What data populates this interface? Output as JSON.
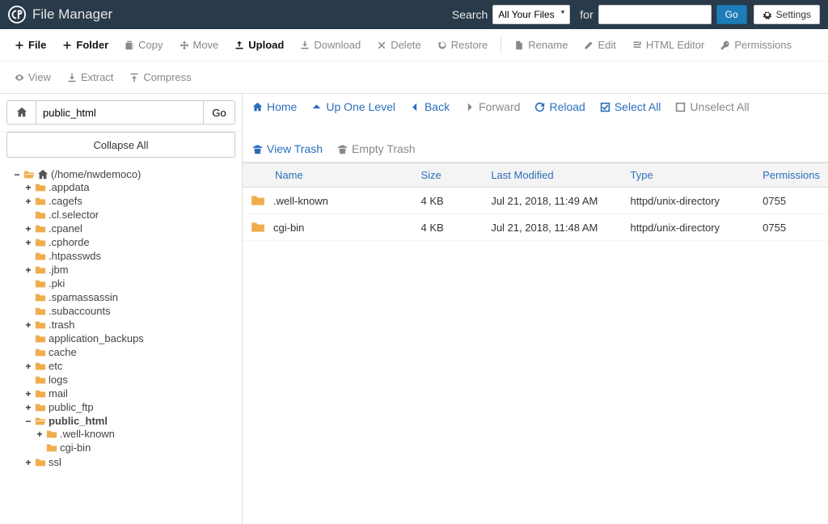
{
  "header": {
    "title": "File Manager",
    "search_label": "Search",
    "search_scope": "All Your Files",
    "for_label": "for",
    "search_term": "",
    "go_label": "Go",
    "settings_label": "Settings"
  },
  "toolbar": {
    "file": "File",
    "folder": "Folder",
    "copy": "Copy",
    "move": "Move",
    "upload": "Upload",
    "download": "Download",
    "delete": "Delete",
    "restore": "Restore",
    "rename": "Rename",
    "edit": "Edit",
    "htmleditor": "HTML Editor",
    "permissions": "Permissions",
    "view": "View",
    "extract": "Extract",
    "compress": "Compress"
  },
  "leftpanel": {
    "path_value": "public_html",
    "go_label": "Go",
    "collapse_all": "Collapse All"
  },
  "tree": {
    "root": "(/home/nwdemoco)",
    "items": [
      {
        "label": ".appdata",
        "expandable": true
      },
      {
        "label": ".cagefs",
        "expandable": true
      },
      {
        "label": ".cl.selector",
        "expandable": false
      },
      {
        "label": ".cpanel",
        "expandable": true
      },
      {
        "label": ".cphorde",
        "expandable": true
      },
      {
        "label": ".htpasswds",
        "expandable": false
      },
      {
        "label": ".jbm",
        "expandable": true
      },
      {
        "label": ".pki",
        "expandable": false
      },
      {
        "label": ".spamassassin",
        "expandable": false
      },
      {
        "label": ".subaccounts",
        "expandable": false
      },
      {
        "label": ".trash",
        "expandable": true
      },
      {
        "label": "application_backups",
        "expandable": false
      },
      {
        "label": "cache",
        "expandable": false
      },
      {
        "label": "etc",
        "expandable": true
      },
      {
        "label": "logs",
        "expandable": false
      },
      {
        "label": "mail",
        "expandable": true
      },
      {
        "label": "public_ftp",
        "expandable": true
      }
    ],
    "public_html": {
      "label": "public_html",
      "children": [
        {
          "label": ".well-known",
          "expandable": true
        },
        {
          "label": "cgi-bin",
          "expandable": false
        }
      ]
    },
    "ssl_label": "ssl"
  },
  "ractions": {
    "home": "Home",
    "up": "Up One Level",
    "back": "Back",
    "forward": "Forward",
    "reload": "Reload",
    "selectall": "Select All",
    "unselectall": "Unselect All",
    "viewtrash": "View Trash",
    "emptytrash": "Empty Trash"
  },
  "table": {
    "headers": {
      "name": "Name",
      "size": "Size",
      "modified": "Last Modified",
      "type": "Type",
      "permissions": "Permissions"
    },
    "rows": [
      {
        "name": ".well-known",
        "size": "4 KB",
        "modified": "Jul 21, 2018, 11:49 AM",
        "type": "httpd/unix-directory",
        "permissions": "0755"
      },
      {
        "name": "cgi-bin",
        "size": "4 KB",
        "modified": "Jul 21, 2018, 11:48 AM",
        "type": "httpd/unix-directory",
        "permissions": "0755"
      }
    ]
  }
}
